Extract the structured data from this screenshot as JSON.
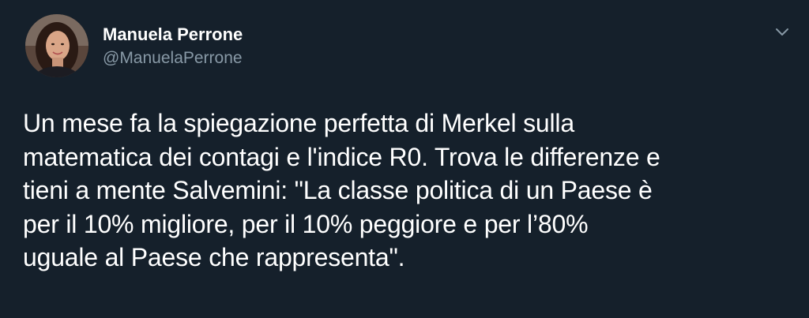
{
  "tweet": {
    "author": {
      "display_name": "Manuela Perrone",
      "handle": "@ManuelaPerrone"
    },
    "text": "Un mese fa la spiegazione perfetta di Merkel sulla\nmatematica dei contagi e l'indice R0. Trova le differenze e\ntieni a mente Salvemini: \"La classe politica di un Paese è\nper il 10% migliore, per il 10% peggiore e per l’80%\nuguale al Paese che rappresenta\".",
    "menu_icon": "chevron-down-icon"
  },
  "colors": {
    "background": "#15202b",
    "text_primary": "#ffffff",
    "text_secondary": "#8899a6"
  }
}
